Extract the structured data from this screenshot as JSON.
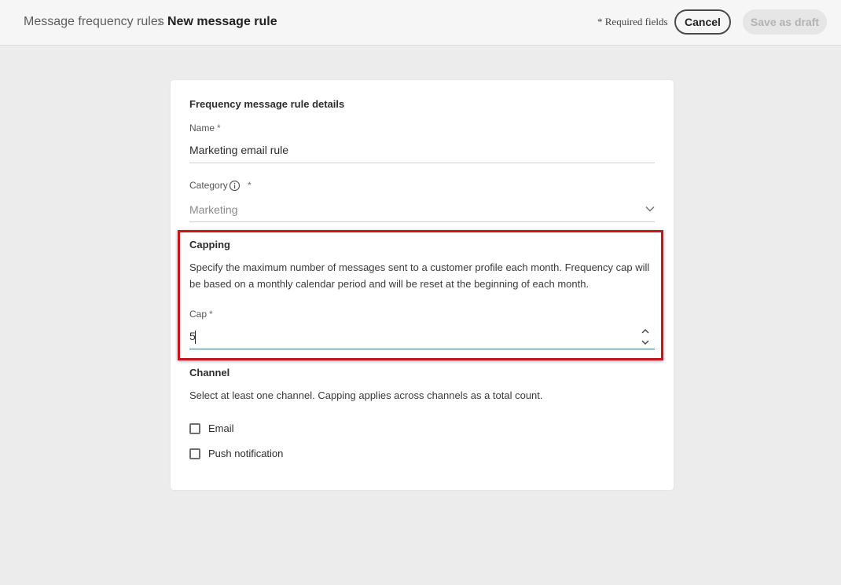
{
  "header": {
    "breadcrumb_parent": "Message frequency rules",
    "breadcrumb_current": "New message rule",
    "required_note": "* Required fields",
    "cancel_label": "Cancel",
    "save_draft_label": "Save as draft"
  },
  "form": {
    "title": "Frequency message rule details",
    "name_label": "Name",
    "name_value": "Marketing email rule",
    "category_label": "Category",
    "category_value": "Marketing",
    "required_mark": "*",
    "capping": {
      "title": "Capping",
      "description_line1": "Specify the maximum number of messages sent to a customer profile each month. Frequency cap will",
      "description_line2": "be based on a monthly calendar period and will be reset at the beginning of each month.",
      "cap_label": "Cap",
      "cap_value": "5"
    },
    "channel": {
      "title": "Channel",
      "description": "Select at least one channel. Capping applies across channels as a total count.",
      "options": [
        {
          "label": "Email",
          "checked": false
        },
        {
          "label": "Push notification",
          "checked": false
        }
      ]
    }
  },
  "colors": {
    "highlight": "#c4161c",
    "background": "#ececec"
  }
}
